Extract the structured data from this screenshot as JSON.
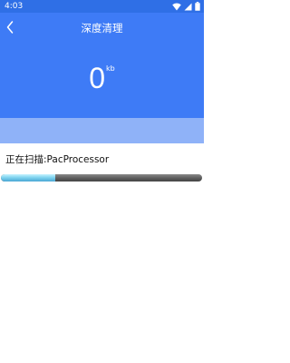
{
  "status_bar": {
    "time": "4:03",
    "icons": [
      "wifi-icon",
      "signal-icon",
      "battery-icon"
    ]
  },
  "header": {
    "title": "深度清理",
    "back_icon": "back-chevron-icon",
    "size_value": "0",
    "size_unit": "kb"
  },
  "scan": {
    "label": "正在扫描:PacProcessor",
    "progress": 0.27
  },
  "colors": {
    "header_bg": "#3e7bf6",
    "status_bg": "#2f6fe6",
    "band_bg": "#8fb2f8",
    "progress_fill": "#7fd4ef",
    "progress_track": "#5c5c5c"
  }
}
